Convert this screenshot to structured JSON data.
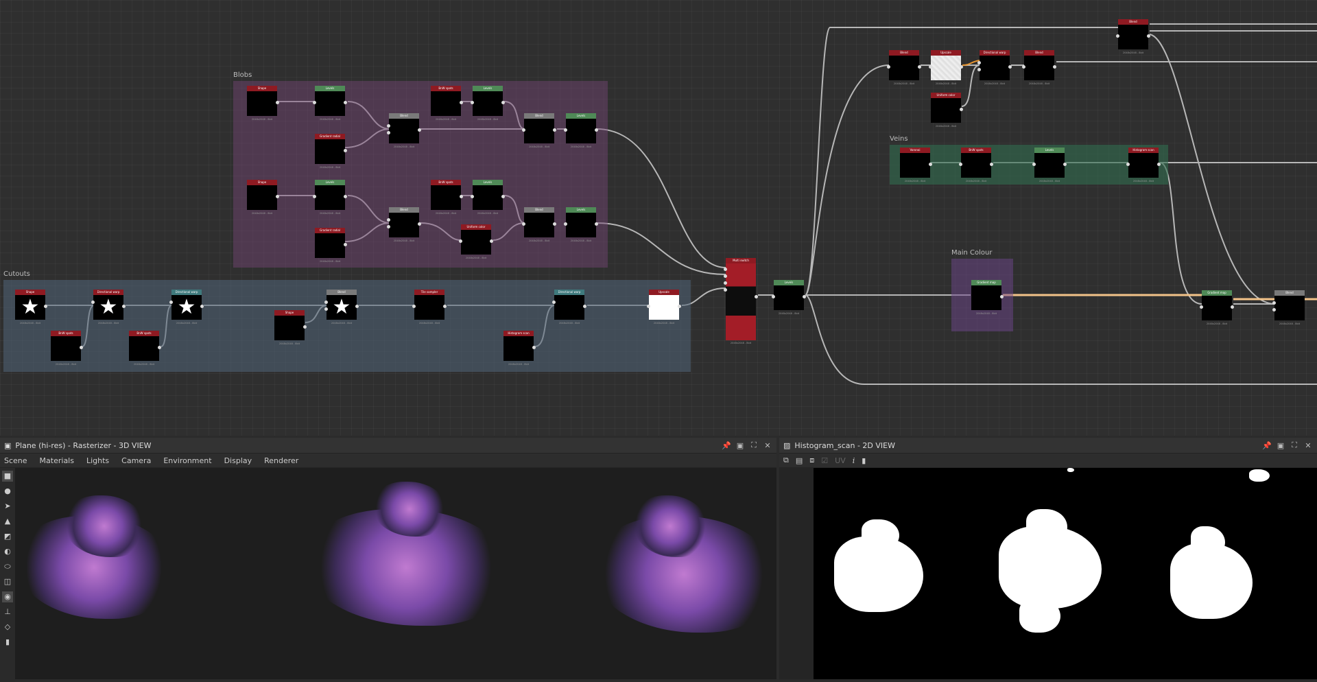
{
  "graph": {
    "frames": {
      "blobs": "Blobs",
      "cutouts": "Cutouts",
      "veins": "Veins",
      "main_colour": "Main Colour"
    },
    "nodes": {
      "shape": "Shape",
      "levels": "Levels",
      "gradient_radial": "Gradient radial",
      "blend": "Blend",
      "upscale": "Upscale",
      "histogram_scan": "Histogram scan",
      "directional_warp": "Directional warp",
      "tile_sampler": "Tile sampler",
      "multi_switch": "Multi switch",
      "uniform_color": "Uniform color",
      "gradient_map": "Gradient map",
      "bnw_spots": "BnW spots",
      "voronoi": "Voronoi"
    },
    "node_caption": "2048x2048 - 8bit"
  },
  "panel3d": {
    "title": "Plane (hi-res) - Rasterizer - 3D VIEW",
    "menu": [
      "Scene",
      "Materials",
      "Lights",
      "Camera",
      "Environment",
      "Display",
      "Renderer"
    ],
    "tools": [
      "camera-icon",
      "light-icon",
      "select-icon",
      "scene-icon",
      "material-icon",
      "shape-icon",
      "env-icon",
      "screenshot-icon",
      "axis-icon",
      "layers-icon",
      "stats-icon"
    ]
  },
  "panel2d": {
    "title": "Histogram_scan - 2D VIEW",
    "toolbar": {
      "uv": "UV",
      "info": "i"
    }
  },
  "header_buttons": {
    "pin": "📌",
    "float": "▣",
    "max": "⛶",
    "close": "✕"
  }
}
